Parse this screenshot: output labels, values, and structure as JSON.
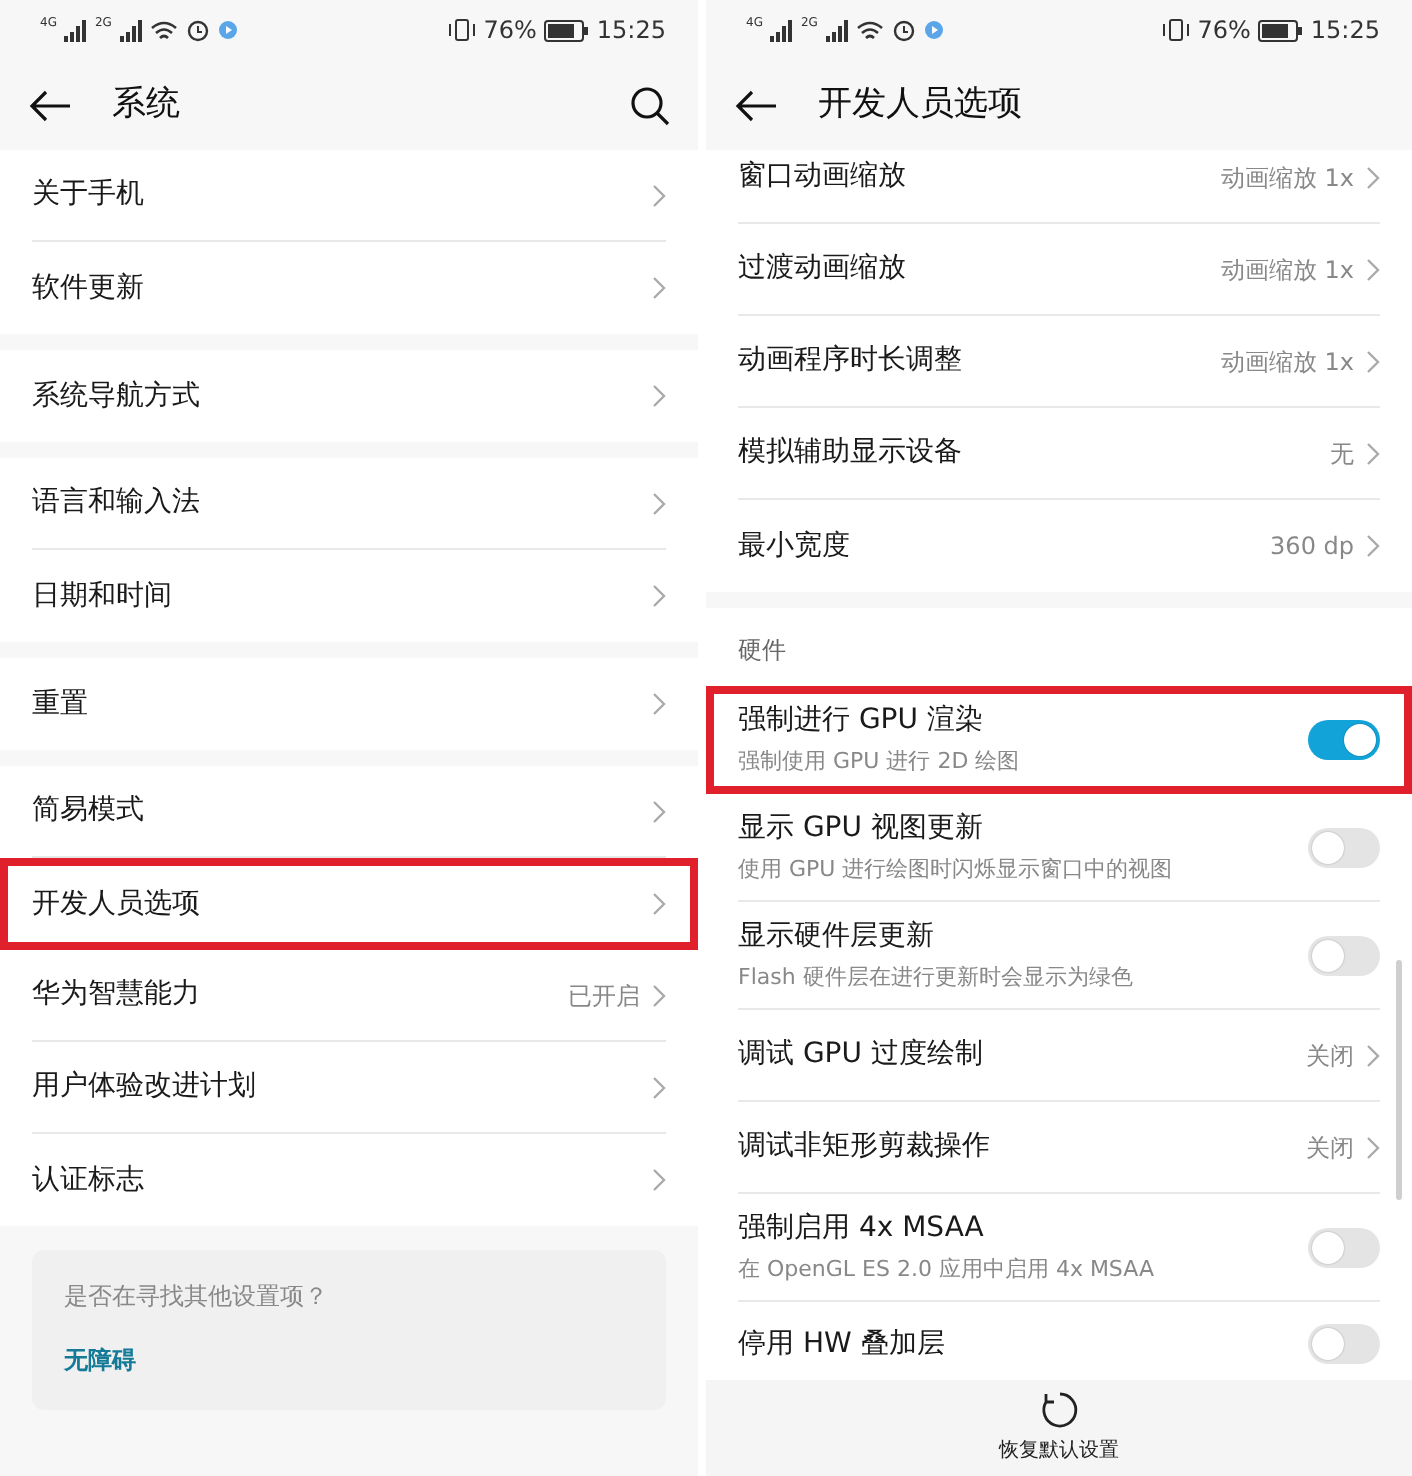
{
  "screens": [
    {
      "status_bar": {
        "network_1": "4G",
        "network_2": "2G",
        "battery": "76%",
        "time": "15:25"
      },
      "title": "系统",
      "search_button": true,
      "groups": [
        {
          "rows": [
            {
              "kind": "link",
              "label": "关于手机",
              "highlighted": false
            },
            {
              "kind": "link",
              "label": "软件更新",
              "highlighted": false
            }
          ]
        },
        {
          "rows": [
            {
              "kind": "link",
              "label": "系统导航方式",
              "highlighted": false
            }
          ]
        },
        {
          "rows": [
            {
              "kind": "link",
              "label": "语言和输入法",
              "highlighted": false
            },
            {
              "kind": "link",
              "label": "日期和时间",
              "highlighted": false
            }
          ]
        },
        {
          "rows": [
            {
              "kind": "link",
              "label": "重置",
              "highlighted": false
            }
          ]
        },
        {
          "rows": [
            {
              "kind": "link",
              "label": "简易模式",
              "highlighted": false
            },
            {
              "kind": "link",
              "label": "开发人员选项",
              "highlighted": true
            },
            {
              "kind": "link",
              "label": "华为智慧能力",
              "value": "已开启",
              "highlighted": false
            },
            {
              "kind": "link",
              "label": "用户体验改进计划",
              "highlighted": false
            },
            {
              "kind": "link",
              "label": "认证标志",
              "highlighted": false
            }
          ]
        }
      ],
      "card": {
        "question": "是否在寻找其他设置项？",
        "link": "无障碍"
      }
    },
    {
      "status_bar": {
        "network_1": "4G",
        "network_2": "2G",
        "battery": "76%",
        "time": "15:25"
      },
      "title": "开发人员选项",
      "groups": [
        {
          "rows": [
            {
              "kind": "link",
              "label": "窗口动画缩放",
              "value": "动画缩放 1x",
              "highlighted": false
            },
            {
              "kind": "link",
              "label": "过渡动画缩放",
              "value": "动画缩放 1x",
              "highlighted": false
            },
            {
              "kind": "link",
              "label": "动画程序时长调整",
              "value": "动画缩放 1x",
              "highlighted": false
            },
            {
              "kind": "link",
              "label": "模拟辅助显示设备",
              "value": "无",
              "highlighted": false
            },
            {
              "kind": "link",
              "label": "最小宽度",
              "value": "360 dp",
              "highlighted": false
            }
          ]
        },
        {
          "title": "硬件",
          "rows": [
            {
              "kind": "switch",
              "label": "强制进行 GPU 渲染",
              "subtitle": "强制使用 GPU 进行 2D 绘图",
              "on": true,
              "highlighted": true
            },
            {
              "kind": "switch",
              "label": "显示 GPU 视图更新",
              "subtitle": "使用 GPU 进行绘图时闪烁显示窗口中的视图",
              "on": false,
              "highlighted": false
            },
            {
              "kind": "switch",
              "label": "显示硬件层更新",
              "subtitle": "Flash 硬件层在进行更新时会显示为绿色",
              "on": false,
              "highlighted": false
            },
            {
              "kind": "link",
              "label": "调试 GPU 过度绘制",
              "value": "关闭",
              "highlighted": false
            },
            {
              "kind": "link",
              "label": "调试非矩形剪裁操作",
              "value": "关闭",
              "highlighted": false
            },
            {
              "kind": "switch",
              "label": "强制启用 4x MSAA",
              "subtitle": "在 OpenGL ES 2.0 应用中启用 4x MSAA",
              "on": false,
              "highlighted": false
            },
            {
              "kind": "switch",
              "label": "停用 HW 叠加层",
              "on": false,
              "highlighted": false
            }
          ]
        }
      ],
      "footer": {
        "label": "恢复默认设置"
      }
    }
  ]
}
